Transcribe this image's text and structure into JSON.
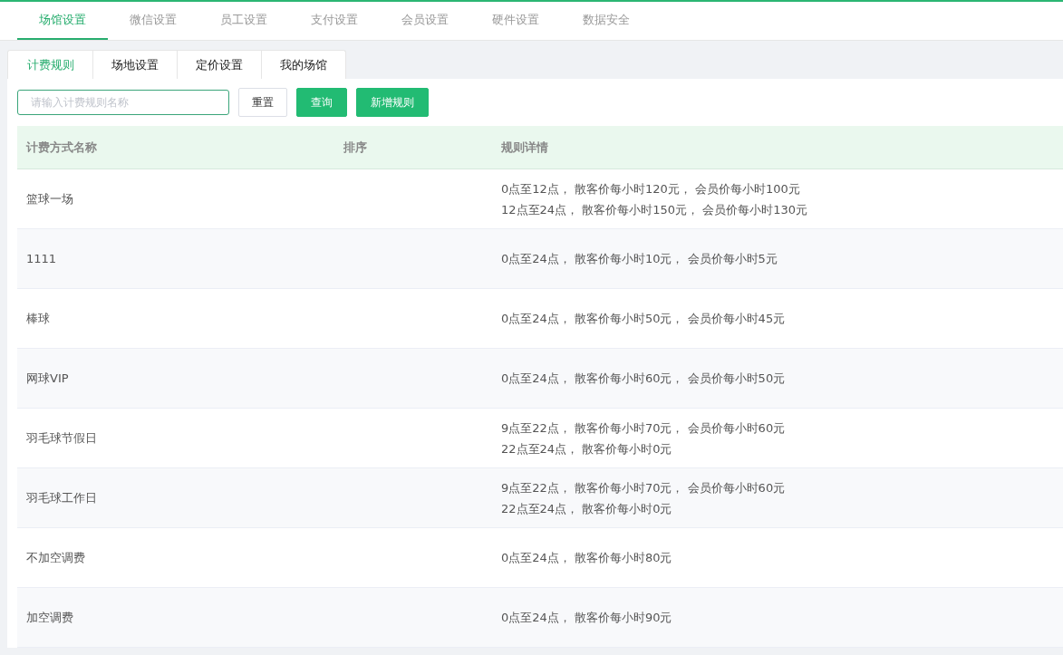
{
  "top_tabs": [
    {
      "label": "场馆设置",
      "selected": true
    },
    {
      "label": "微信设置",
      "selected": false
    },
    {
      "label": "员工设置",
      "selected": false
    },
    {
      "label": "支付设置",
      "selected": false
    },
    {
      "label": "会员设置",
      "selected": false
    },
    {
      "label": "硬件设置",
      "selected": false
    },
    {
      "label": "数据安全",
      "selected": false
    }
  ],
  "sub_tabs": [
    {
      "label": "计费规则",
      "selected": true
    },
    {
      "label": "场地设置",
      "selected": false
    },
    {
      "label": "定价设置",
      "selected": false
    },
    {
      "label": "我的场馆",
      "selected": false
    }
  ],
  "search": {
    "placeholder": "请输入计费规则名称"
  },
  "buttons": [
    {
      "label": "重置",
      "kind": "plain"
    },
    {
      "label": "查询",
      "kind": "primary"
    },
    {
      "label": "新增规则",
      "kind": "primary"
    }
  ],
  "table": {
    "columns": [
      "计费方式名称",
      "排序",
      "规则详情"
    ],
    "rows": [
      {
        "name": "篮球一场",
        "details": [
          "0点至12点， 散客价每小时120元， 会员价每小时100元",
          "12点至24点， 散客价每小时150元， 会员价每小时130元"
        ]
      },
      {
        "name": "1111",
        "details": [
          "0点至24点， 散客价每小时10元， 会员价每小时5元"
        ]
      },
      {
        "name": "棒球",
        "details": [
          "0点至24点， 散客价每小时50元， 会员价每小时45元"
        ]
      },
      {
        "name": "网球VIP",
        "details": [
          "0点至24点， 散客价每小时60元， 会员价每小时50元"
        ]
      },
      {
        "name": "羽毛球节假日",
        "details": [
          "9点至22点， 散客价每小时70元， 会员价每小时60元",
          "22点至24点， 散客价每小时0元"
        ]
      },
      {
        "name": "羽毛球工作日",
        "details": [
          "9点至22点， 散客价每小时70元， 会员价每小时60元",
          "22点至24点， 散客价每小时0元"
        ]
      },
      {
        "name": "不加空调费",
        "details": [
          "0点至24点， 散客价每小时80元"
        ]
      },
      {
        "name": "加空调费",
        "details": [
          "0点至24点， 散客价每小时90元"
        ]
      }
    ]
  }
}
